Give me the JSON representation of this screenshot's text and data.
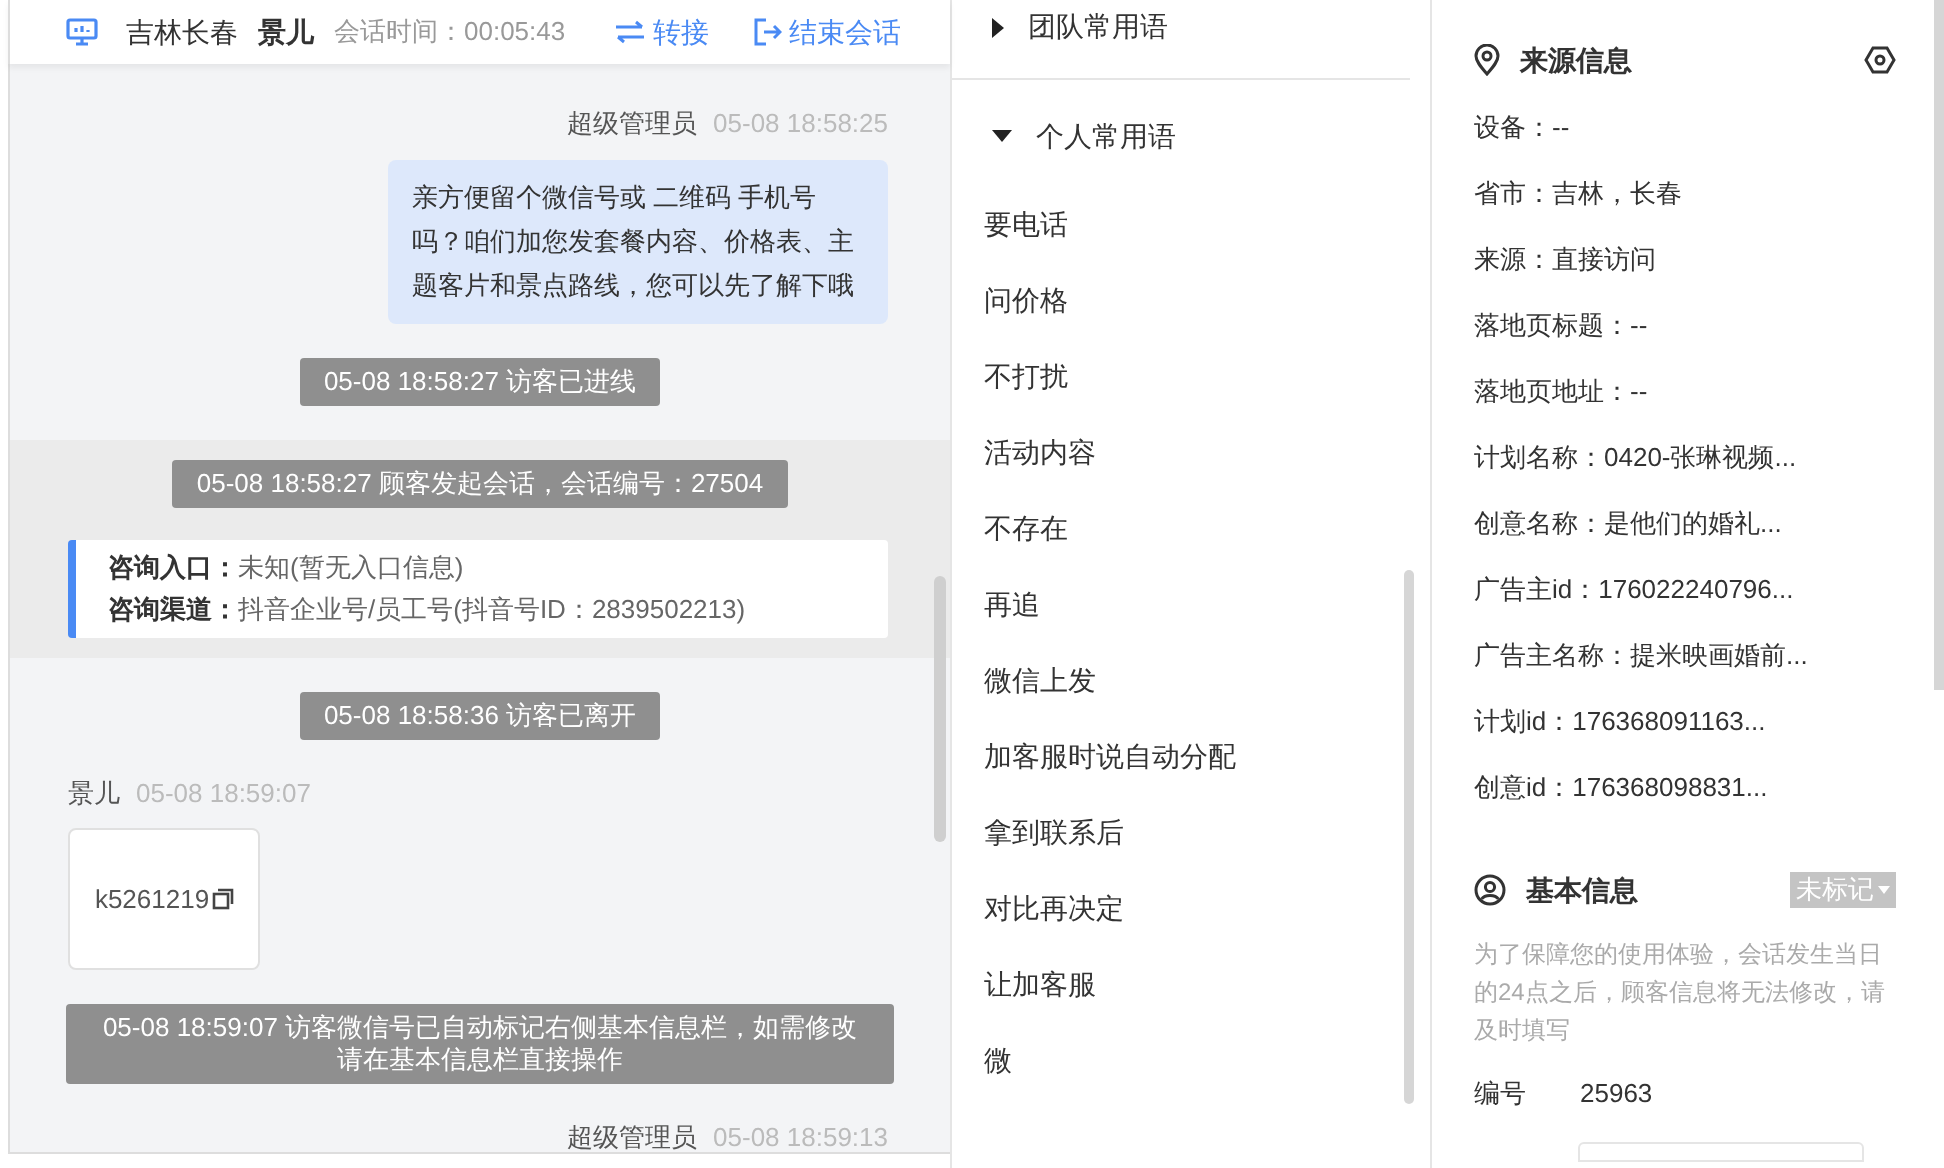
{
  "chat_header": {
    "location": "吉林长春",
    "visitor": "景儿",
    "duration_label": "会话时间：",
    "duration": "00:05:43",
    "actions": [
      {
        "kind": "transfer",
        "label": "转接"
      },
      {
        "kind": "end",
        "label": "结束会话"
      }
    ]
  },
  "messages": [
    {
      "kind": "agent",
      "name": "超级管理员",
      "time": "05-08 18:58:25",
      "text": "亲方便留个微信号或 二维码 手机号吗？咱们加您发套餐内容、价格表、主题客片和景点路线，您可以先了解下哦"
    },
    {
      "kind": "system",
      "text": "05-08 18:58:27 访客已进线"
    },
    {
      "kind": "session",
      "notice": "05-08 18:58:27 顾客发起会话，会话编号：27504",
      "rows": [
        {
          "label": "咨询入口：",
          "value": "未知(暂无入口信息)"
        },
        {
          "label": "咨询渠道：",
          "value": "抖音企业号/员工号(抖音号ID：2839502213)"
        }
      ]
    },
    {
      "kind": "system",
      "text": "05-08 18:58:36 访客已离开"
    },
    {
      "kind": "visitor",
      "name": "景儿",
      "time": "05-08 18:59:07",
      "text": "k5261219"
    },
    {
      "kind": "system",
      "text": "05-08 18:59:07 访客微信号已自动标记右侧基本信息栏，如需修改请在基本信息栏直接操作"
    },
    {
      "kind": "agent",
      "name": "超级管理员",
      "time": "05-08 18:59:13"
    }
  ],
  "phrases": {
    "groups": [
      {
        "label": "团队常用语",
        "expanded": false
      },
      {
        "label": "个人常用语",
        "expanded": true
      }
    ],
    "items": [
      "要电话",
      "问价格",
      "不打扰",
      "活动内容",
      "不存在",
      "再追",
      "微信上发",
      "加客服时说自动分配",
      "拿到联系后",
      "对比再决定",
      "让加客服",
      "微"
    ]
  },
  "source_info": {
    "title": "来源信息",
    "fields": [
      "设备：--",
      "省市：吉林，长春",
      "来源：直接访问",
      "落地页标题：--",
      "落地页地址：--",
      "计划名称：0420-张琳视频...",
      "创意名称：是他们的婚礼...",
      "广告主id：176022240796...",
      "广告主名称：提米映画婚前...",
      "计划id：176368091163...",
      "创意id：176368098831..."
    ]
  },
  "basic_info": {
    "title": "基本信息",
    "tag": "未标记",
    "note": "为了保障您的使用体验，会话发生当日的24点之后，顾客信息将无法修改，请及时填写",
    "fields": [
      {
        "label": "编号",
        "value": "25963"
      }
    ]
  }
}
